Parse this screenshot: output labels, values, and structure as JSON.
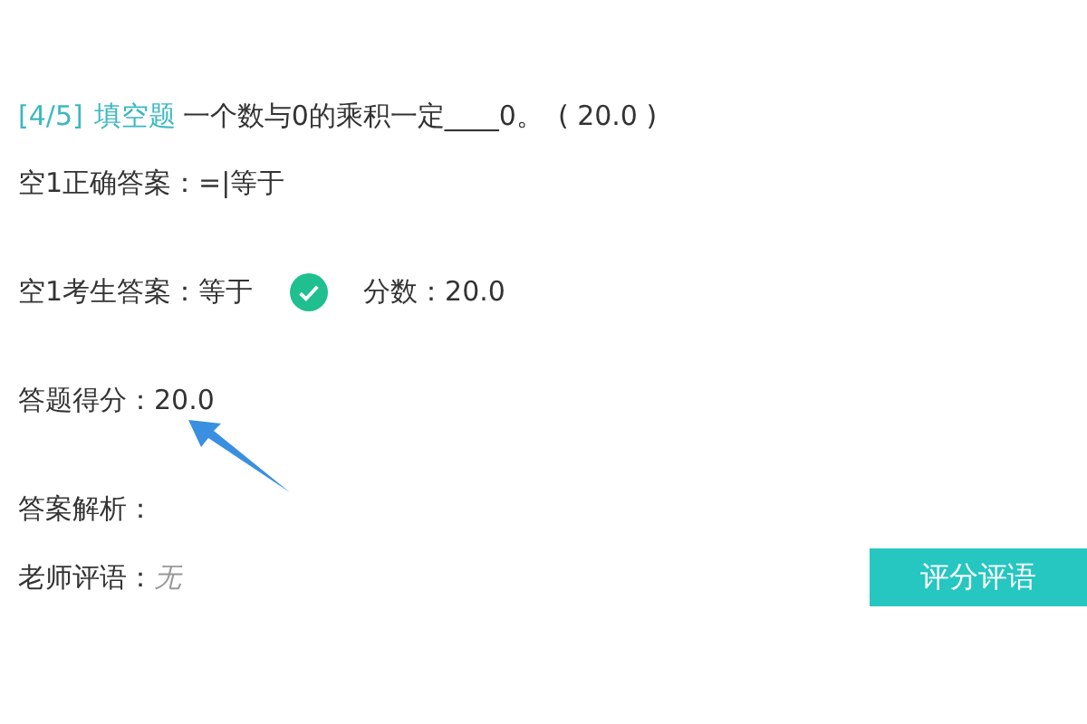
{
  "question": {
    "index": "[4/5]",
    "type": "填空题",
    "text": "一个数与0的乘积一定____0。",
    "points": "( 20.0 )"
  },
  "correct_answer": {
    "label": "空1正确答案：",
    "value": "=|等于"
  },
  "student_answer": {
    "label": "空1考生答案：",
    "value": "等于",
    "correct": true,
    "score_label": "分数：",
    "score": "20.0"
  },
  "total": {
    "label": "答题得分：",
    "value": "20.0"
  },
  "analysis": {
    "label": "答案解析："
  },
  "comment": {
    "label": "老师评语：",
    "value": "无"
  },
  "button": "评分评语"
}
